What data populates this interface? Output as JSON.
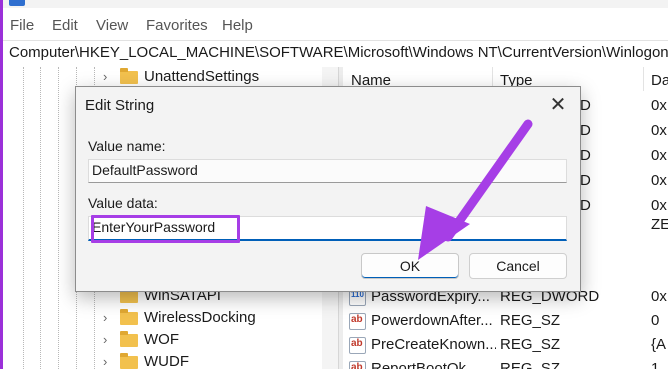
{
  "menu": {
    "items": [
      "File",
      "Edit",
      "View",
      "Favorites",
      "Help"
    ]
  },
  "address": {
    "path": "Computer\\HKEY_LOCAL_MACHINE\\SOFTWARE\\Microsoft\\Windows NT\\CurrentVersion\\Winlogon"
  },
  "tree": {
    "items": [
      {
        "label": "UnattendSettings"
      },
      {
        "label": "WinSATAPI"
      },
      {
        "label": "WirelessDocking"
      },
      {
        "label": "WOF"
      },
      {
        "label": "WUDF"
      }
    ]
  },
  "list": {
    "headers": {
      "name": "Name",
      "type": "Type",
      "data": "Da"
    },
    "partial_types": [
      "D",
      "D",
      "D",
      "D",
      "D"
    ],
    "partial_data": [
      "0x",
      "0x",
      "0x",
      "0x",
      "0x",
      "ZE"
    ],
    "rows": [
      {
        "name": "PasswordExpiry...",
        "type": "REG_DWORD",
        "data": "0x",
        "icon": "binary-value-icon"
      },
      {
        "name": "PowerdownAfter...",
        "type": "REG_SZ",
        "data": "0",
        "icon": "string-value-icon"
      },
      {
        "name": "PreCreateKnown...",
        "type": "REG_SZ",
        "data": "{A",
        "icon": "string-value-icon"
      },
      {
        "name": "ReportBootOk",
        "type": "REG_SZ",
        "data": "1",
        "icon": "string-value-icon"
      }
    ]
  },
  "dialog": {
    "title": "Edit String",
    "value_name_label": "Value name:",
    "value_name": "DefaultPassword",
    "value_data_label": "Value data:",
    "value_data": "EnterYourPassword",
    "ok_label": "OK",
    "cancel_label": "Cancel"
  },
  "colors": {
    "accent": "#005fb8",
    "annotation": "#a63ee6"
  }
}
